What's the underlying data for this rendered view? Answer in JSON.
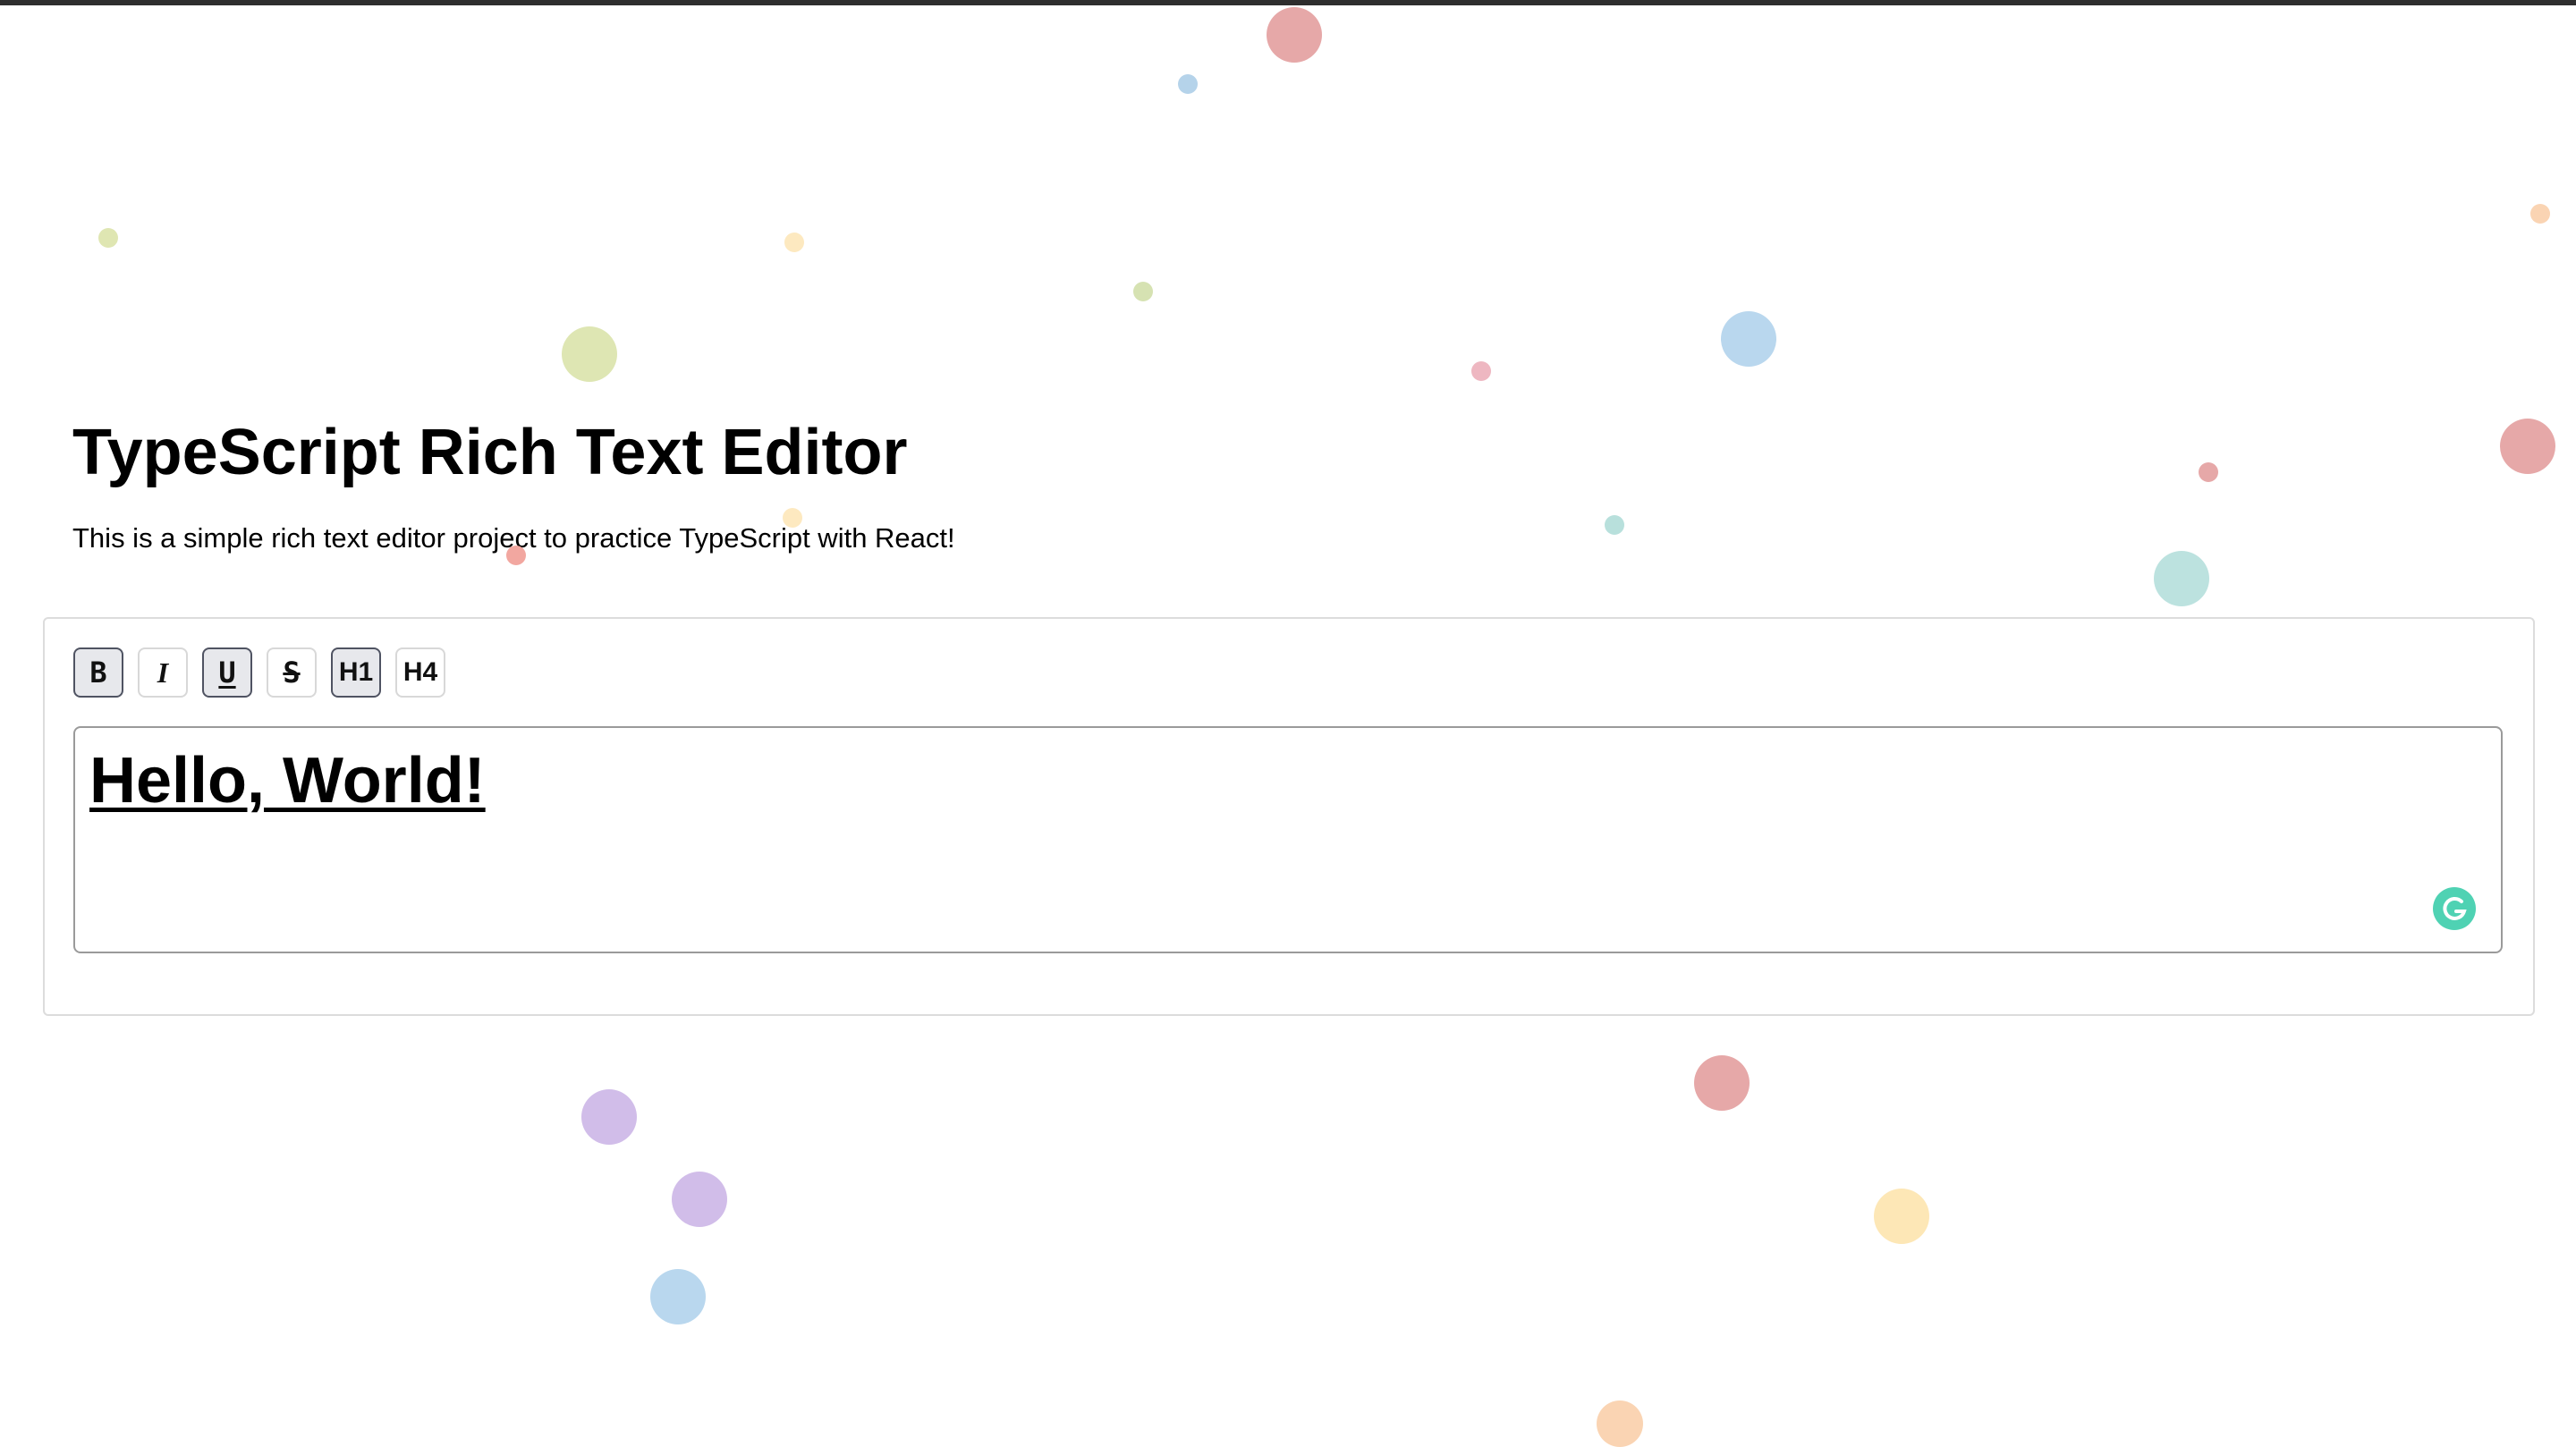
{
  "page": {
    "title": "TypeScript Rich Text Editor",
    "description": "This is a simple rich text editor project to practice TypeScript with React!"
  },
  "toolbar": {
    "buttons": [
      {
        "label": "B",
        "action": "bold",
        "active": true
      },
      {
        "label": "I",
        "action": "italic",
        "active": false
      },
      {
        "label": "U",
        "action": "underline",
        "active": true
      },
      {
        "label": "S",
        "action": "strikethrough",
        "active": false
      },
      {
        "label": "H1",
        "action": "heading-1",
        "active": true
      },
      {
        "label": "H4",
        "action": "heading-4",
        "active": false
      }
    ]
  },
  "editor": {
    "content": "Hello, World!"
  },
  "icons": {
    "grammarly": "grammarly-icon"
  },
  "colors": {
    "active_button_bg": "#e7e8ec",
    "active_button_border": "#4f5362",
    "grammarly_green": "#15c39a"
  }
}
